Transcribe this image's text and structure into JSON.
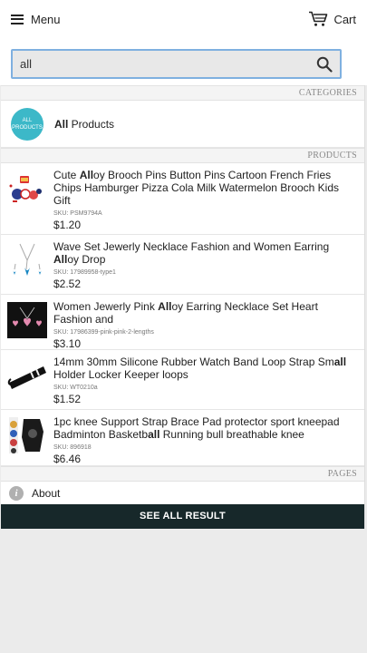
{
  "header": {
    "menu_label": "Menu",
    "cart_label": "Cart"
  },
  "search": {
    "value": "all"
  },
  "sections": {
    "categories": "CATEGORIES",
    "products": "PRODUCTS",
    "pages": "PAGES"
  },
  "category": {
    "badge_line1": "ALL",
    "badge_line2": "PRODUCTS",
    "match": "All",
    "rest": " Products"
  },
  "products": [
    {
      "name_before": "Cute ",
      "name_match": "All",
      "name_after": "oy Brooch Pins Button Pins Cartoon French Fries Chips Hamburger Pizza Cola Milk Watermelon Brooch Kids Gift",
      "sku": "SKU: PSM9794A",
      "price": "$1.20"
    },
    {
      "name_before": "Wave Set Jewerly Necklace Fashion and Women Earring ",
      "name_match": "All",
      "name_after": "oy Drop",
      "sku": "SKU: 17989958-type1",
      "price": "$2.52"
    },
    {
      "name_before": "Women Jewerly Pink ",
      "name_match": "All",
      "name_after": "oy Earring Necklace Set Heart Fashion and",
      "sku": "SKU: 17986399-pink-pink-2-lengths",
      "price": "$3.10"
    },
    {
      "name_before": "14mm 30mm Silicone Rubber Watch Band Loop Strap Sm",
      "name_match": "all",
      "name_after": " Holder Locker Keeper loops",
      "sku": "SKU: WT0210a",
      "price": "$1.52"
    },
    {
      "name_before": "1pc knee Support Strap Brace Pad protector sport kneepad Badminton Basketb",
      "name_match": "all",
      "name_after": " Running bull breathable knee",
      "sku": "SKU: 896918",
      "price": "$6.46"
    }
  ],
  "pages": {
    "about_label": "About",
    "info_glyph": "i"
  },
  "footer": {
    "see_all_label": "SEE ALL RESULT"
  }
}
